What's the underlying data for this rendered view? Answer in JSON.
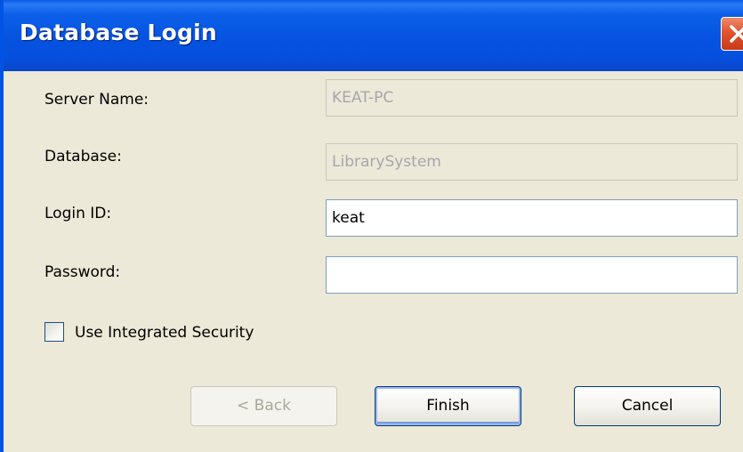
{
  "window": {
    "title": "Database Login"
  },
  "form": {
    "server_name": {
      "label": "Server Name:",
      "value": "KEAT-PC",
      "enabled": false
    },
    "database": {
      "label": "Database:",
      "value": "LibrarySystem",
      "enabled": false
    },
    "login_id": {
      "label": "Login ID:",
      "value": "keat",
      "enabled": true
    },
    "password": {
      "label": "Password:",
      "value": "",
      "enabled": true
    },
    "integrated_security": {
      "label": "Use Integrated Security",
      "checked": false
    }
  },
  "buttons": {
    "back": {
      "label": "< Back",
      "enabled": false
    },
    "finish": {
      "label": "Finish",
      "enabled": true
    },
    "cancel": {
      "label": "Cancel",
      "enabled": true
    }
  },
  "icons": {
    "close": "close-icon"
  },
  "colors": {
    "titlebar": "#0553e0",
    "window_bg": "#ece9d8",
    "close_button": "#e0542e",
    "field_border": "#7f9db9"
  }
}
